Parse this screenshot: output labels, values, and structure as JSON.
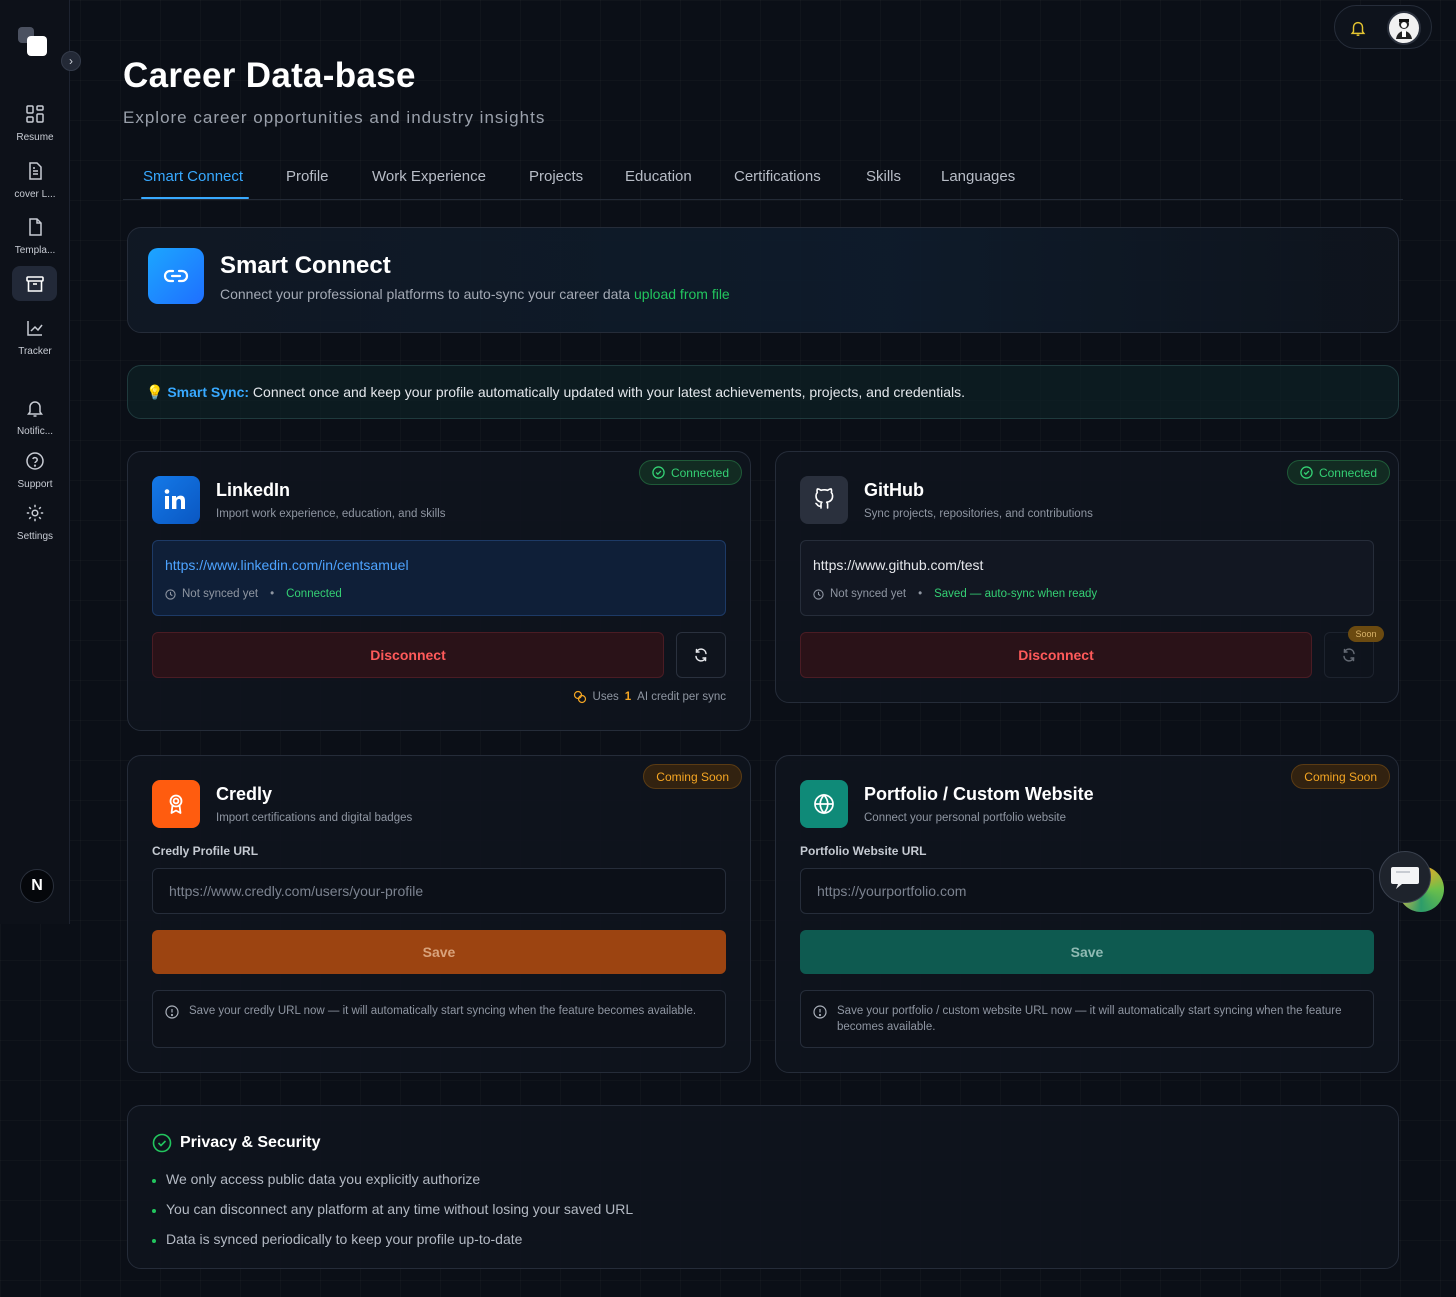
{
  "sidebar": {
    "items": [
      {
        "label": "Resume",
        "icon": "grid-icon"
      },
      {
        "label": "cover L...",
        "icon": "document-icon"
      },
      {
        "label": "Templa...",
        "icon": "file-icon"
      },
      {
        "label": "",
        "icon": "archive-icon"
      },
      {
        "label": "Tracker",
        "icon": "chart-line-icon"
      },
      {
        "label": "Notific...",
        "icon": "bell-icon"
      },
      {
        "label": "Support",
        "icon": "help-circle-icon"
      },
      {
        "label": "Settings",
        "icon": "gear-icon"
      }
    ],
    "user_initial": "N"
  },
  "header": {
    "title": "Career Data-base",
    "subtitle": "Explore career opportunities and industry insights"
  },
  "tabs": [
    {
      "label": "Smart Connect",
      "active": true
    },
    {
      "label": "Profile"
    },
    {
      "label": "Work Experience"
    },
    {
      "label": "Projects"
    },
    {
      "label": "Education"
    },
    {
      "label": "Certifications"
    },
    {
      "label": "Skills"
    },
    {
      "label": "Languages"
    }
  ],
  "smart_connect": {
    "title": "Smart Connect",
    "description": "Connect your professional platforms to auto-sync your career data",
    "link": "upload from file"
  },
  "smart_sync": {
    "icon": "💡",
    "label": "Smart Sync:",
    "text": "Connect once and keep your profile automatically updated with your latest achievements, projects, and credentials."
  },
  "platforms": {
    "linkedin": {
      "title": "LinkedIn",
      "description": "Import work experience, education, and skills",
      "badge": "Connected",
      "url": "https://www.linkedin.com/in/centsamuel",
      "sync_status": "Not synced yet",
      "bullet": "•",
      "status": "Connected",
      "button": "Disconnect",
      "credit_prefix": "Uses",
      "credit_count": "1",
      "credit_suffix": "AI credit per sync"
    },
    "github": {
      "title": "GitHub",
      "description": "Sync projects, repositories, and contributions",
      "badge": "Connected",
      "url": "https://www.github.com/test",
      "sync_status": "Not synced yet",
      "bullet": "•",
      "status": "Saved — auto-sync when ready",
      "button": "Disconnect",
      "soon": "Soon"
    },
    "credly": {
      "title": "Credly",
      "description": "Import certifications and digital badges",
      "badge": "Coming Soon",
      "field_label": "Credly Profile URL",
      "placeholder": "https://www.credly.com/users/your-profile",
      "button": "Save",
      "info": "Save your credly URL now — it will automatically start syncing when the feature becomes available."
    },
    "portfolio": {
      "title": "Portfolio / Custom Website",
      "description": "Connect your personal portfolio website",
      "badge": "Coming Soon",
      "field_label": "Portfolio Website URL",
      "placeholder": "https://yourportfolio.com",
      "button": "Save",
      "info": "Save your portfolio / custom website URL now — it will automatically start syncing when the feature becomes available."
    }
  },
  "privacy": {
    "title": "Privacy & Security",
    "items": [
      "We only access public data you explicitly authorize",
      "You can disconnect any platform at any time without losing your saved URL",
      "Data is synced periodically to keep your profile up-to-date"
    ]
  },
  "colors": {
    "accent_blue": "#38a9ff",
    "success_green": "#34d074",
    "danger_red": "#ff5a5a",
    "amber": "#f5a623",
    "credly_orange": "#ff5c0f",
    "portfolio_teal": "#0f8a78",
    "linkedin_blue": "#0a66c2"
  }
}
